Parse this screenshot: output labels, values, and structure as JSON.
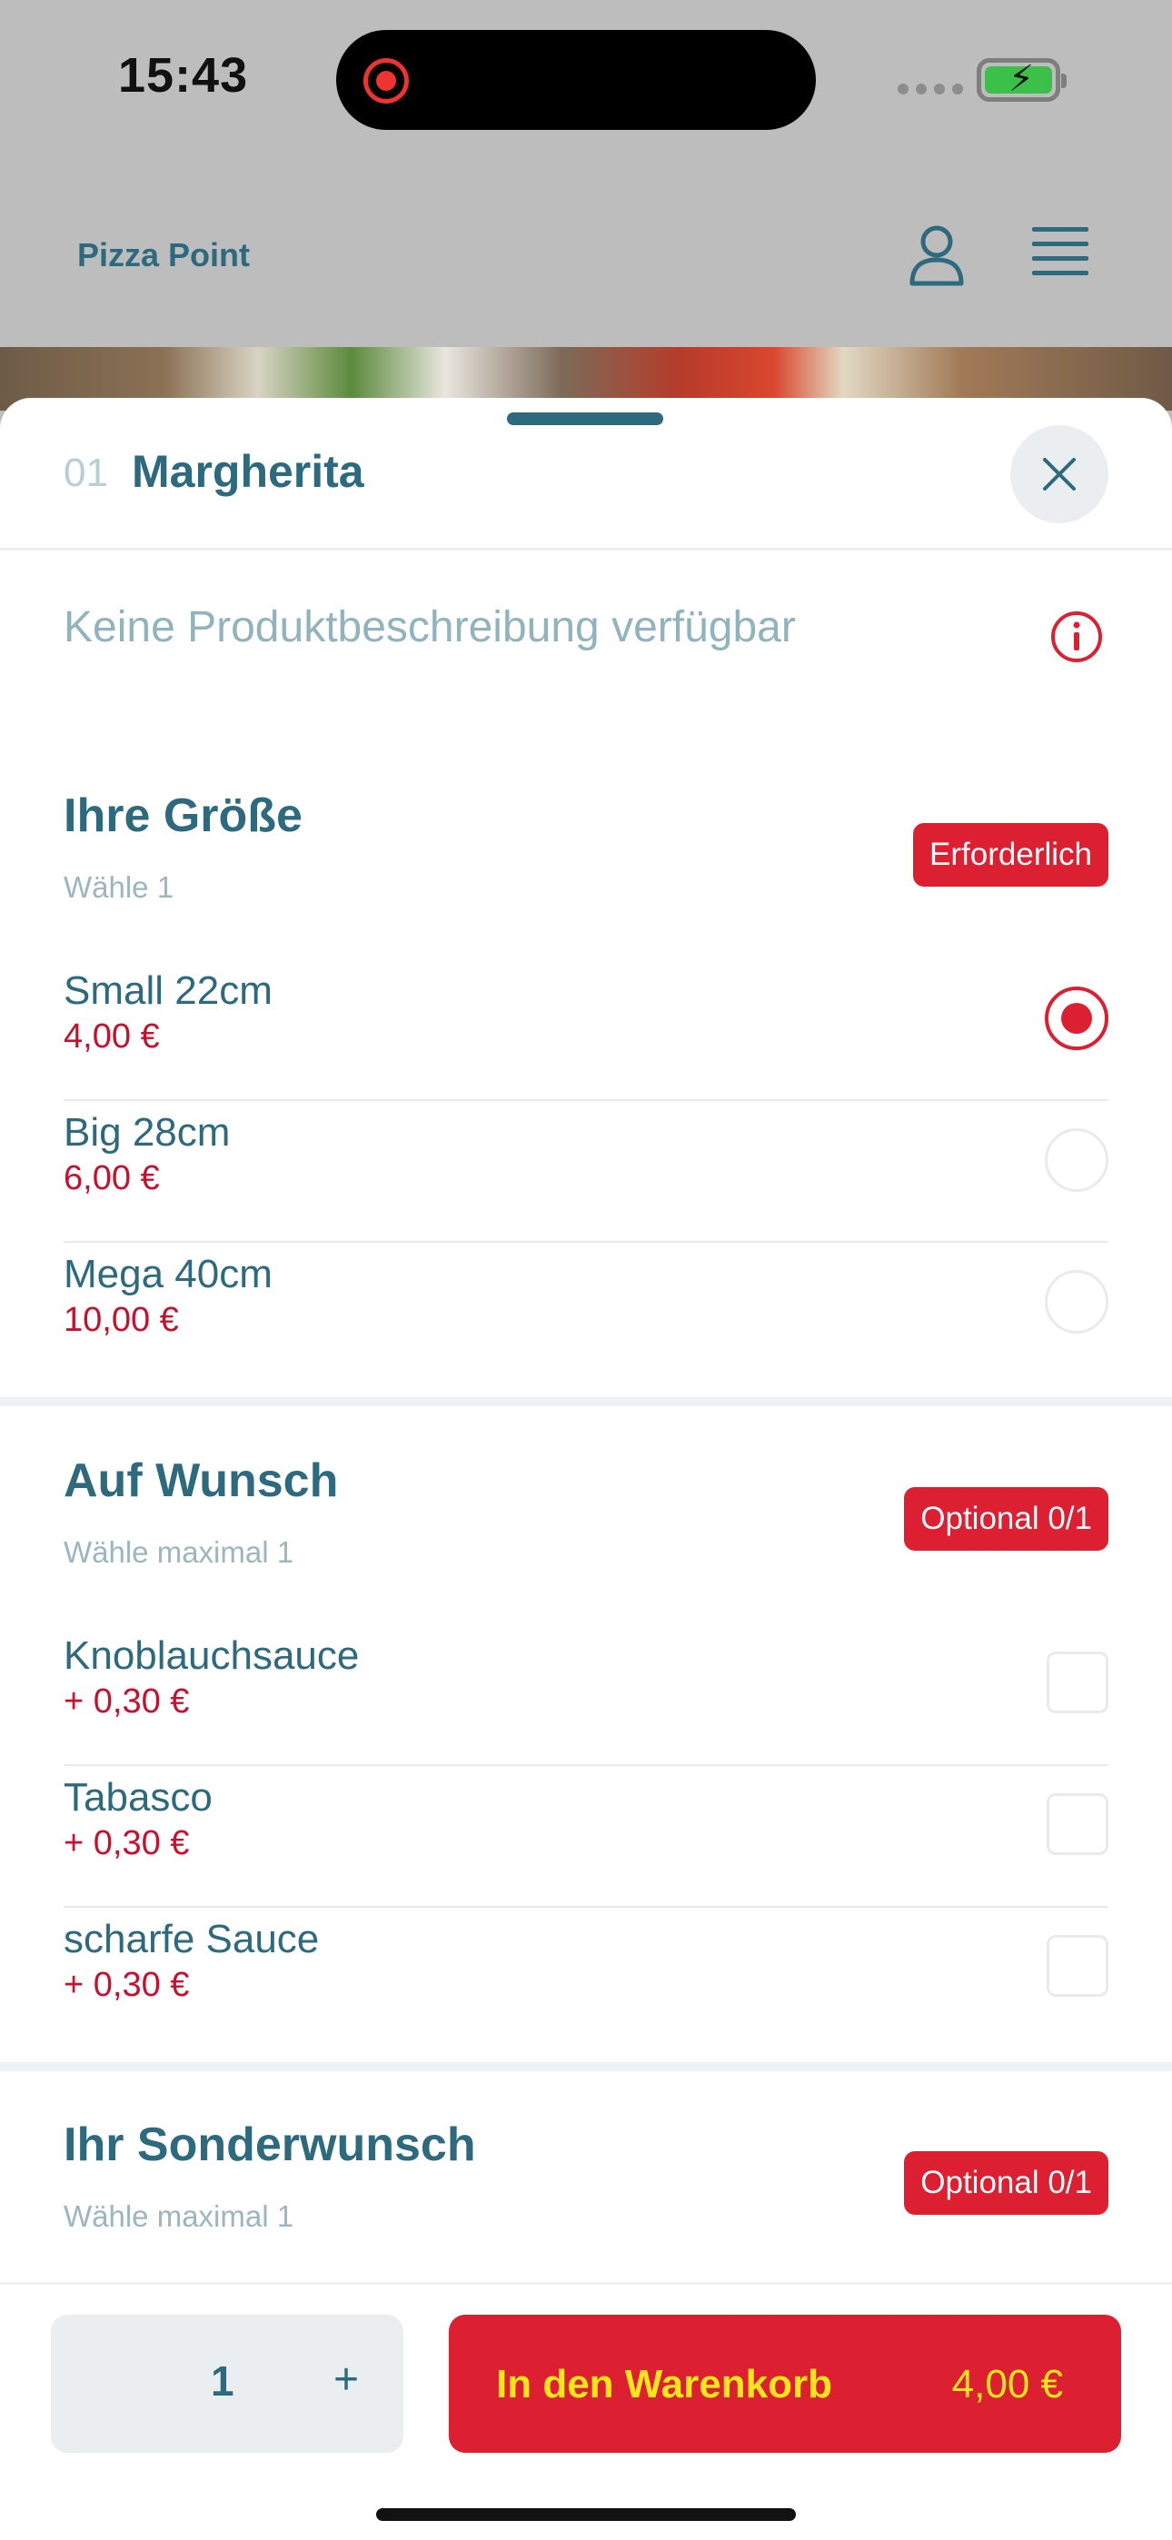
{
  "status_bar": {
    "time": "15:43"
  },
  "header": {
    "brand": "Pizza Point"
  },
  "product": {
    "number": "01",
    "name": "Margherita",
    "description": "Keine Produktbeschreibung verfügbar"
  },
  "sections": [
    {
      "title": "Ihre Größe",
      "subtitle": "Wähle 1",
      "badge": "Erforderlich",
      "type": "radio",
      "options": [
        {
          "label": "Small 22cm",
          "price": "4,00 €",
          "selected": true
        },
        {
          "label": "Big 28cm",
          "price": "6,00 €",
          "selected": false
        },
        {
          "label": "Mega 40cm",
          "price": "10,00 €",
          "selected": false
        }
      ]
    },
    {
      "title": "Auf Wunsch",
      "subtitle": "Wähle maximal 1",
      "badge": "Optional 0/1",
      "type": "checkbox",
      "options": [
        {
          "label": "Knoblauchsauce",
          "price": "+ 0,30 €",
          "selected": false
        },
        {
          "label": "Tabasco",
          "price": "+ 0,30 €",
          "selected": false
        },
        {
          "label": "scharfe Sauce",
          "price": "+ 0,30 €",
          "selected": false
        }
      ]
    },
    {
      "title": "Ihr Sonderwunsch",
      "subtitle": "Wähle maximal 1",
      "badge": "Optional 0/1"
    }
  ],
  "cart": {
    "quantity": "1",
    "plus": "+",
    "button_label": "In den Warenkorb",
    "price": "4,00 €"
  },
  "colors": {
    "accent_red": "#dc1f31",
    "primary_teal": "#2e6a7e",
    "button_text_yellow": "#f7e61a"
  },
  "icons": [
    "user-icon",
    "menu-icon",
    "close-icon",
    "info-icon",
    "battery-icon",
    "record-icon"
  ]
}
